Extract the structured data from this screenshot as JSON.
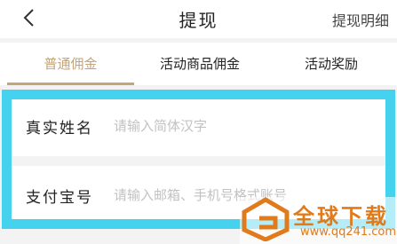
{
  "header": {
    "title": "提现",
    "action_label": "提现明细",
    "back_icon": "chevron-left-icon"
  },
  "tabs": [
    {
      "label": "普通佣金",
      "active": true
    },
    {
      "label": "活动商品佣金",
      "active": false
    },
    {
      "label": "活动奖励",
      "active": false
    }
  ],
  "form": {
    "fields": [
      {
        "label": "真实姓名",
        "placeholder": "请输入简体汉字",
        "value": ""
      },
      {
        "label": "支付宝号",
        "placeholder": "请输入邮箱、手机号格式账号",
        "value": ""
      }
    ]
  },
  "watermark": {
    "text": "全球下载",
    "url": "www.qq241.com"
  },
  "colors": {
    "accent": "#c4a57a",
    "highlight_border": "#45d2ee",
    "background": "#f3f3f3",
    "watermark": "#e07a1a"
  }
}
